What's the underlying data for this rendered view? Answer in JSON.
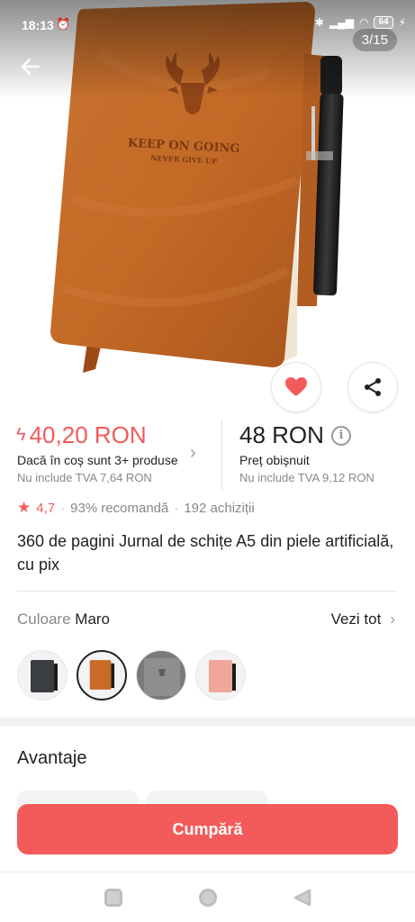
{
  "status_bar": {
    "time": "18:13",
    "battery": "64"
  },
  "gallery": {
    "counter": "3/15",
    "emboss_line1": "KEEP ON GOING",
    "emboss_line2": "NEVER GIVE UP"
  },
  "price": {
    "promo_price": "40,20 RON",
    "promo_condition": "Dacă în coș sunt 3+ produse",
    "promo_vat": "Nu include TVA 7,64 RON",
    "regular_price": "48 RON",
    "regular_label": "Preț obișnuit",
    "regular_vat": "Nu include TVA 9,12 RON"
  },
  "rating": {
    "value": "4,7",
    "recommend": "93% recomandă",
    "purchases": "192 achiziții"
  },
  "product": {
    "title": "360 de pagini Jurnal de schițe A5 din piele artificială, cu pix"
  },
  "color": {
    "label": "Culoare",
    "selected": "Maro",
    "see_all": "Vezi tot",
    "options": [
      {
        "name": "negru",
        "hex": "#3a3d42"
      },
      {
        "name": "maro",
        "hex": "#c96a28"
      },
      {
        "name": "gri",
        "hex": "#8e8e8e"
      },
      {
        "name": "roz",
        "hex": "#f0a69a"
      }
    ]
  },
  "advantages": {
    "title": "Avantaje"
  },
  "cta": {
    "buy": "Cumpără"
  },
  "colors": {
    "accent": "#f35a5a",
    "notebook": "#c96a28"
  }
}
